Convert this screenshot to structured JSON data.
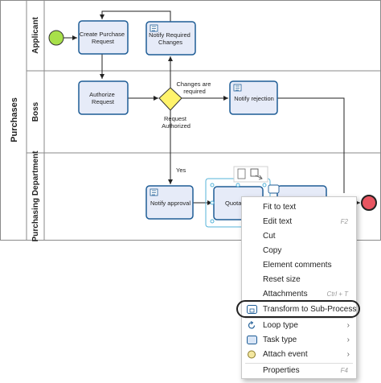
{
  "pool": {
    "label": "Purchases"
  },
  "lanes": [
    {
      "label": "Applicant"
    },
    {
      "label": "Boss"
    },
    {
      "label": "Purchasing Department"
    }
  ],
  "tasks": {
    "create_purchase_request": "Create Purchase Request",
    "notify_required_changes": "Notify Required Changes",
    "authorize_request": "Authorize Request",
    "notify_rejection": "Notify rejection",
    "notify_approval": "Notify approval",
    "quotation": "Quota"
  },
  "flows": {
    "changes_are_required": "Changes are required",
    "request_authorized": "Request Authorized",
    "yes": "Yes"
  },
  "context_menu": {
    "items": [
      {
        "label": "Fit to text",
        "shortcut": ""
      },
      {
        "label": "Edit text",
        "shortcut": "F2"
      },
      {
        "label": "Cut",
        "shortcut": ""
      },
      {
        "label": "Copy",
        "shortcut": ""
      },
      {
        "label": "Element comments",
        "shortcut": ""
      },
      {
        "label": "Reset size",
        "shortcut": ""
      },
      {
        "label": "Attachments",
        "shortcut": "Ctrl + T"
      },
      {
        "label": "Transform to Sub-Process",
        "shortcut": ""
      },
      {
        "label": "Loop type",
        "shortcut": ""
      },
      {
        "label": "Task type",
        "shortcut": ""
      },
      {
        "label": "Attach event",
        "shortcut": ""
      },
      {
        "label": "Properties",
        "shortcut": "F4"
      }
    ]
  },
  "colors": {
    "task_fill": "#e6ebf8",
    "task_stroke": "#1f5d96",
    "start_fill": "#a8e04a",
    "end_fill": "#e85561",
    "gateway_fill": "#fff36b",
    "lane_line": "#8a8a8a",
    "selection": "#55b3d9"
  }
}
